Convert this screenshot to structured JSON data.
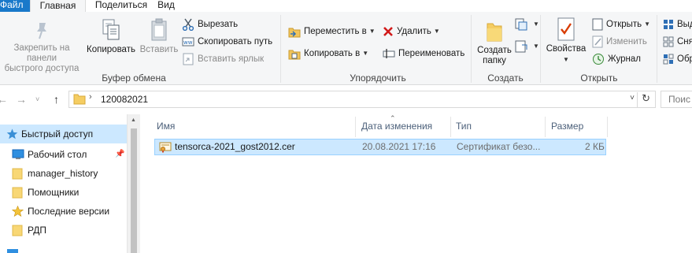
{
  "ribbon_tabs": {
    "file": "Файл",
    "home": "Главная",
    "share": "Поделиться",
    "view": "Вид"
  },
  "clipboard": {
    "pin_label_1": "Закрепить на панели",
    "pin_label_2": "быстрого доступа",
    "copy": "Копировать",
    "paste": "Вставить",
    "cut": "Вырезать",
    "copy_path": "Скопировать путь",
    "paste_shortcut": "Вставить ярлык",
    "group_label": "Буфер обмена"
  },
  "organize": {
    "move_to": "Переместить в",
    "copy_to": "Копировать в",
    "delete": "Удалить",
    "rename": "Переименовать",
    "group_label": "Упорядочить"
  },
  "create": {
    "new_folder_1": "Создать",
    "new_folder_2": "папку",
    "group_label": "Создать"
  },
  "open": {
    "properties": "Свойства",
    "open": "Открыть",
    "edit": "Изменить",
    "history": "Журнал",
    "group_label": "Открыть"
  },
  "select": {
    "item1": "Выд",
    "item2": "Сня",
    "item3": "Обр"
  },
  "address": {
    "path": "120082021",
    "search_placeholder": "Поис"
  },
  "nav_pane": {
    "items": [
      {
        "label": "Быстрый доступ",
        "icon": "star-icon"
      },
      {
        "label": "Рабочий стол",
        "icon": "desktop-icon"
      },
      {
        "label": "manager_history",
        "icon": "folder-icon"
      },
      {
        "label": "Помощники",
        "icon": "folder-icon"
      },
      {
        "label": "Последние версии",
        "icon": "star-icon"
      },
      {
        "label": "РДП",
        "icon": "folder-icon"
      }
    ]
  },
  "file_list": {
    "columns": {
      "name": "Имя",
      "date": "Дата изменения",
      "type": "Тип",
      "size": "Размер"
    },
    "rows": [
      {
        "name": "tensorca-2021_gost2012.cer",
        "date": "20.08.2021 17:16",
        "type": "Сертификат безо...",
        "size": "2 КБ",
        "icon": "certificate-icon"
      }
    ]
  },
  "colors": {
    "accent": "#1979ca",
    "selection": "#cce8ff",
    "selection_border": "#99d1ff",
    "ribbon_bg": "#f5f6f7"
  }
}
